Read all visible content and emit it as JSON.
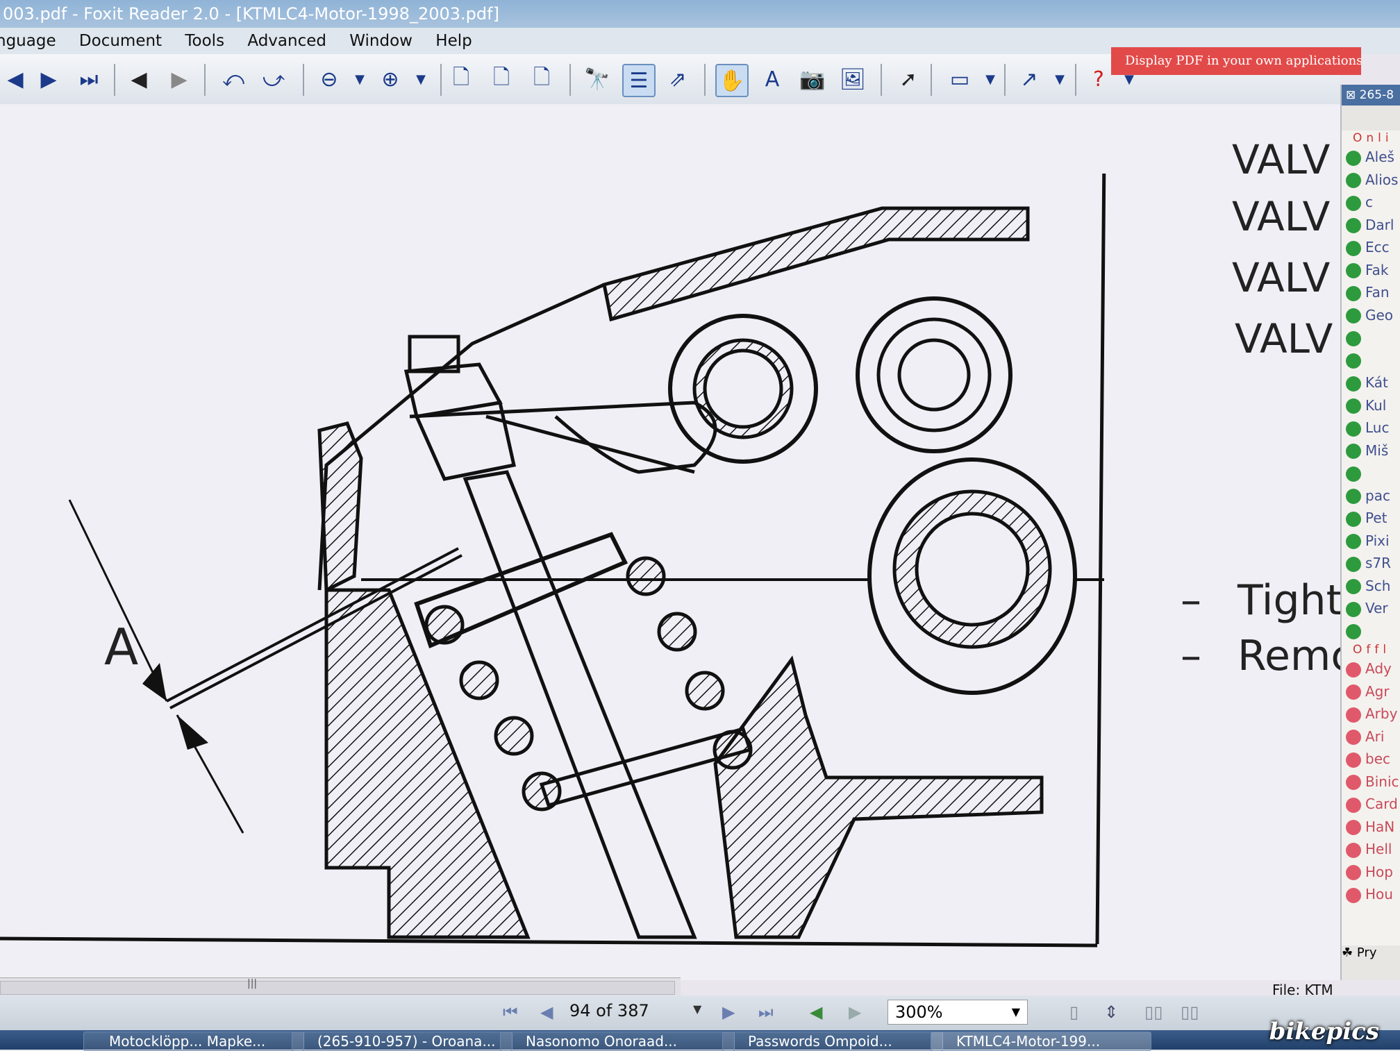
{
  "window": {
    "title": "003.pdf - Foxit Reader 2.0 - [KTMLC4-Motor-1998_2003.pdf]"
  },
  "menu": [
    "nguage",
    "Document",
    "Tools",
    "Advanced",
    "Window",
    "Help"
  ],
  "toolbar": {
    "ad_text": "Display PDF in your own applications"
  },
  "document": {
    "headings": [
      "VALV",
      "VALV",
      "VALV",
      "VALV"
    ],
    "bullets": [
      "Tight",
      "Remc"
    ],
    "figure_label": "A"
  },
  "status": {
    "page": "94 of 387",
    "zoom": "300%",
    "file": "File: KTM"
  },
  "contacts": {
    "header": "265-8",
    "online_label": "Onli",
    "online": [
      "Aleš",
      "Alios",
      "c",
      "Darl",
      "Ecc",
      "Fak",
      "Fan",
      "Geo",
      "",
      "",
      "Kát",
      "Kul",
      "Luc",
      "Miš",
      "",
      "pac",
      "Pet",
      "Pixi",
      "s7R",
      "Sch",
      "Ver",
      ""
    ],
    "offline_label": "Offl",
    "offline": [
      "Ady",
      "Agr",
      "Arby",
      "Ari",
      "bec",
      "Binic",
      "Card",
      "HaN",
      "Hell",
      "Hop",
      "Hou"
    ],
    "bottom_label": "Pry"
  },
  "taskbar": {
    "items": [
      "Motocklöpp... Mapke...",
      "(265-910-957) - Oroana...",
      "Nasonomo Onoraad...",
      "Passwords Ompoid...",
      "KTMLC4-Motor-199..."
    ]
  },
  "watermark": "bikepics"
}
